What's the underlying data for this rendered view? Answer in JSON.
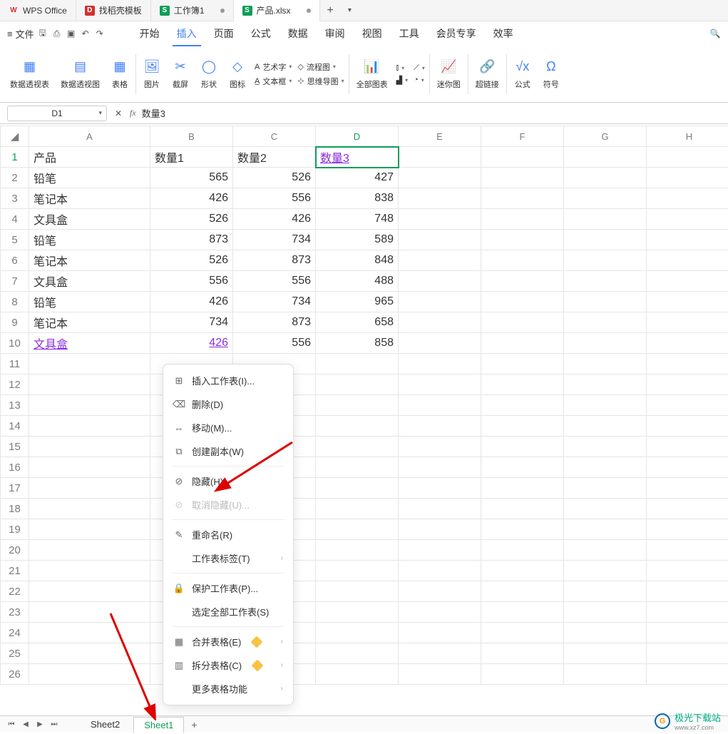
{
  "title_tabs": [
    {
      "icon": "W",
      "label": "WPS Office",
      "cls": "wps"
    },
    {
      "icon": "D",
      "label": "找稻壳模板",
      "cls": "d"
    },
    {
      "icon": "S",
      "label": "工作簿1",
      "cls": "s",
      "dot": true
    },
    {
      "icon": "S",
      "label": "产品.xlsx",
      "cls": "s",
      "dot": true,
      "active": true
    }
  ],
  "menu": {
    "file": "文件",
    "items": [
      "开始",
      "插入",
      "页面",
      "公式",
      "数据",
      "审阅",
      "视图",
      "工具",
      "会员专享",
      "效率"
    ],
    "active": "插入"
  },
  "ribbon": {
    "g1": [
      {
        "l": "数据透视表"
      },
      {
        "l": "数据透视图"
      },
      {
        "l": "表格"
      }
    ],
    "g2": [
      {
        "l": "图片"
      },
      {
        "l": "截屏"
      },
      {
        "l": "形状"
      },
      {
        "l": "图标"
      }
    ],
    "g2col": [
      "艺术字",
      "文本框",
      "流程图",
      "思维导图"
    ],
    "g3": [
      {
        "l": "全部图表"
      }
    ],
    "g4": [
      {
        "l": "迷你图"
      }
    ],
    "g5": [
      {
        "l": "超链接"
      }
    ],
    "g6": [
      {
        "l": "公式"
      },
      {
        "l": "符号"
      }
    ]
  },
  "formula_bar": {
    "cell": "D1",
    "value": "数量3"
  },
  "columns": [
    "A",
    "B",
    "C",
    "D",
    "E",
    "F",
    "G",
    "H"
  ],
  "row_count": 26,
  "active_cell": {
    "row": 1,
    "col": "D"
  },
  "data": {
    "1": {
      "A": "产品",
      "B": "数量1",
      "C": "数量2",
      "D": "数量3"
    },
    "2": {
      "A": "铅笔",
      "B": 565,
      "C": 526,
      "D": 427
    },
    "3": {
      "A": "笔记本",
      "B": 426,
      "C": 556,
      "D": 838
    },
    "4": {
      "A": "文具盒",
      "B": 526,
      "C": 426,
      "D": 748
    },
    "5": {
      "A": "铅笔",
      "B": 873,
      "C": 734,
      "D": 589
    },
    "6": {
      "A": "笔记本",
      "B": 526,
      "C": 873,
      "D": 848
    },
    "7": {
      "A": "文具盒",
      "B": 556,
      "C": 556,
      "D": 488
    },
    "8": {
      "A": "铅笔",
      "B": 426,
      "C": 734,
      "D": 965
    },
    "9": {
      "A": "笔记本",
      "B": 734,
      "C": 873,
      "D": 658
    },
    "10": {
      "A": "文具盒",
      "B": 426,
      "C": 556,
      "D": 858
    }
  },
  "sheet_tabs": {
    "tabs": [
      "Sheet2",
      "Sheet1"
    ],
    "active": "Sheet1"
  },
  "context_menu": [
    {
      "icon": "⊞",
      "label": "插入工作表(I)..."
    },
    {
      "icon": "⌫",
      "label": "删除(D)"
    },
    {
      "icon": "↔",
      "label": "移动(M)..."
    },
    {
      "icon": "⧉",
      "label": "创建副本(W)"
    },
    {
      "sep": true
    },
    {
      "icon": "⊘",
      "label": "隐藏(H)"
    },
    {
      "icon": "⊘",
      "label": "取消隐藏(U)...",
      "disabled": true
    },
    {
      "sep": true
    },
    {
      "icon": "✎",
      "label": "重命名(R)"
    },
    {
      "icon": "",
      "label": "工作表标签(T)",
      "arrow": true
    },
    {
      "sep": true
    },
    {
      "icon": "🔒",
      "label": "保护工作表(P)..."
    },
    {
      "icon": "",
      "label": "选定全部工作表(S)"
    },
    {
      "sep": true
    },
    {
      "icon": "▦",
      "label": "合并表格(E)",
      "diamond": true,
      "arrow": true
    },
    {
      "icon": "▥",
      "label": "拆分表格(C)",
      "diamond": true,
      "arrow": true
    },
    {
      "icon": "",
      "label": "更多表格功能",
      "arrow": true
    }
  ],
  "watermark": {
    "name": "极光下载站",
    "url": "www.xz7.com"
  }
}
